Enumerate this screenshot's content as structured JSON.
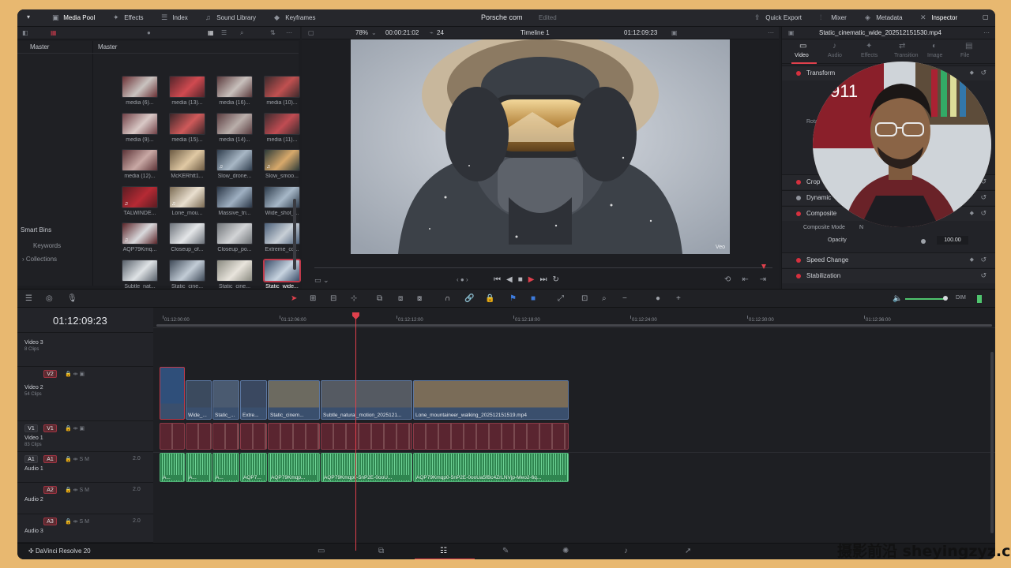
{
  "topbar": {
    "media_pool": "Media Pool",
    "effects": "Effects",
    "index": "Index",
    "sound_library": "Sound Library",
    "keyframes": "Keyframes",
    "project_title": "Porsche com",
    "project_state": "Edited",
    "quick_export": "Quick Export",
    "mixer": "Mixer",
    "metadata": "Metadata",
    "inspector": "Inspector"
  },
  "media_pool": {
    "bin_master": "Master",
    "grid_master": "Master",
    "smart_bins": "Smart Bins",
    "keywords": "Keywords",
    "collections": "Collections",
    "clips": [
      "media (6)...",
      "media (13)...",
      "media (16)...",
      "media (10)...",
      "media (9)...",
      "media (15)...",
      "media (14)...",
      "media (11)...",
      "media (12)...",
      "McKERhtt1...",
      "Slow_drone...",
      "Slow_smoo...",
      "TALWINDE...",
      "Lone_mou...",
      "Massive_tri...",
      "Wide_shot_...",
      "AQP79Kmq...",
      "Closeup_of...",
      "Closeup_po...",
      "Extreme_co...",
      "Subtle_nat...",
      "Static_cine...",
      "Static_cine...",
      "Static_wide..."
    ]
  },
  "viewer": {
    "zoom": "78%",
    "source_tc": "00:00:21:02",
    "fps": "24",
    "timeline_name": "Timeline 1",
    "record_tc": "01:12:09:23",
    "veo_mark": "Veo"
  },
  "inspector": {
    "clip_name": "Static_cinematic_wide_202512151530.mp4",
    "tabs": [
      "Video",
      "Audio",
      "Effects",
      "Transition",
      "Image",
      "File"
    ],
    "transform": "Transform",
    "crop": "Crop",
    "dynamic_zoom": "Dynamic",
    "composite": "Composite",
    "composite_mode": "Composite Mode",
    "composite_mode_value": "N",
    "opacity_label": "Opacity",
    "opacity_value": "100.00",
    "speed_change": "Speed Change",
    "stabilization": "Stabilization",
    "rotation_label": "Rota"
  },
  "timeline": {
    "timecode": "01:12:09:23",
    "dim": "DIM",
    "ruler": [
      "01:12:00:00",
      "01:12:06:00",
      "01:12:12:00",
      "01:12:18:00",
      "01:12:24:00",
      "01:12:30:00",
      "01:12:36:00"
    ],
    "tracks": [
      {
        "id": "video3",
        "name": "Video 3",
        "sub": "8 Clips"
      },
      {
        "id": "video2",
        "name": "Video 2",
        "sub": "54 Clips",
        "tag": "V2"
      },
      {
        "id": "video1",
        "name": "Video 1",
        "sub": "83 Clips",
        "tag": "V1",
        "tag2": "V1"
      },
      {
        "id": "audio1",
        "name": "Audio 1",
        "tag": "A1",
        "tag2": "A1",
        "level": "2.0"
      },
      {
        "id": "audio2",
        "name": "Audio 2",
        "tag": "A2",
        "level": "2.0"
      },
      {
        "id": "audio3",
        "name": "Audio 3",
        "tag": "A3",
        "level": "2.0"
      }
    ],
    "video2_clips": [
      "",
      "Wide_...",
      "Static_...",
      "Extre...",
      "Static_cinem...",
      "Subtle_natural_motion_2025121...",
      "Lone_mountaineer_walking_202512151519.mp4"
    ],
    "audio1_clips": [
      "A...",
      "A...",
      "A...",
      "AQP7...",
      "AQP79Kmqp...",
      "AQP79Kmqp0-5nP2E-0ooU...",
      "AQP79Kmqp0-5nP2E-0ooUa5fBc4ZrLNVjp-Meo2-6q..."
    ]
  },
  "footer": {
    "app_name": "DaVinci Resolve 20"
  },
  "watermark": "摄影前沿 sheyingzyz.com"
}
